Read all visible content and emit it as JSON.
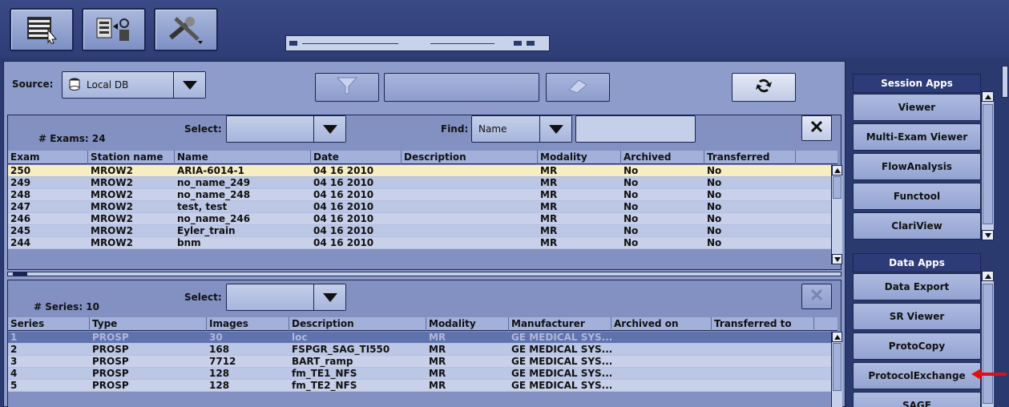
{
  "toolbar": {
    "icons": [
      "browser-list-icon",
      "network-transfer-icon",
      "tools-icon"
    ]
  },
  "source_bar": {
    "source_label": "Source:",
    "source_value": "Local DB"
  },
  "exams": {
    "count_label": "# Exams: 24",
    "select_label": "Select:",
    "find_label": "Find:",
    "find_value": "Name",
    "find_input": "",
    "columns": [
      "Exam",
      "Station name",
      "Name",
      "Date",
      "Description",
      "Modality",
      "Archived",
      "Transferred"
    ],
    "rows": [
      [
        "250",
        "MROW2",
        "ARIA-6014-1",
        "04 16 2010",
        "",
        "MR",
        "No",
        "No"
      ],
      [
        "249",
        "MROW2",
        "no_name_249",
        "04 16 2010",
        "",
        "MR",
        "No",
        "No"
      ],
      [
        "248",
        "MROW2",
        "no_name_248",
        "04 16 2010",
        "",
        "MR",
        "No",
        "No"
      ],
      [
        "247",
        "MROW2",
        "test, test",
        "04 16 2010",
        "",
        "MR",
        "No",
        "No"
      ],
      [
        "246",
        "MROW2",
        "no_name_246",
        "04 16 2010",
        "",
        "MR",
        "No",
        "No"
      ],
      [
        "245",
        "MROW2",
        "Eyler_train",
        "04 16 2010",
        "",
        "MR",
        "No",
        "No"
      ],
      [
        "244",
        "MROW2",
        "bnm",
        "04 16 2010",
        "",
        "MR",
        "No",
        "No"
      ]
    ]
  },
  "series": {
    "count_label": "# Series: 10",
    "select_label": "Select:",
    "columns": [
      "Series",
      "Type",
      "Images",
      "Description",
      "Modality",
      "Manufacturer",
      "Archived on",
      "Transferred to"
    ],
    "rows": [
      [
        "1",
        "PROSP",
        "30",
        "loc",
        "MR",
        "GE MEDICAL SYS...",
        "",
        ""
      ],
      [
        "2",
        "PROSP",
        "168",
        "FSPGR_SAG_TI550",
        "MR",
        "GE MEDICAL SYS...",
        "",
        ""
      ],
      [
        "3",
        "PROSP",
        "7712",
        "BART_ramp",
        "MR",
        "GE MEDICAL SYS...",
        "",
        ""
      ],
      [
        "4",
        "PROSP",
        "128",
        "fm_TE1_NFS",
        "MR",
        "GE MEDICAL SYS...",
        "",
        ""
      ],
      [
        "5",
        "PROSP",
        "128",
        "fm_TE2_NFS",
        "MR",
        "GE MEDICAL SYS...",
        "",
        ""
      ]
    ]
  },
  "session_apps": {
    "title": "Session Apps",
    "items": [
      "Viewer",
      "Multi-Exam Viewer",
      "FlowAnalysis",
      "Functool",
      "ClariView"
    ]
  },
  "data_apps": {
    "title": "Data Apps",
    "items": [
      "Data Export",
      "SR Viewer",
      "ProtoCopy",
      "ProtocolExchange",
      "SAGE"
    ]
  },
  "colors": {
    "background": "#2b3a6e",
    "panel": "#8e9ccb",
    "selected_exam_row": "#f6edc0",
    "selected_series_row": "#5f72ad",
    "annotation_arrow": "#e01010"
  }
}
